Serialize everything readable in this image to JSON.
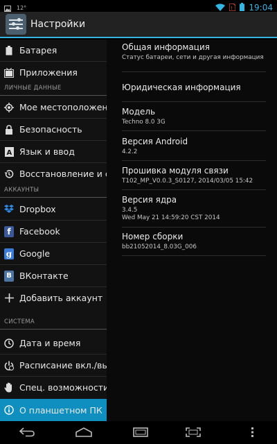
{
  "status_bar": {
    "temperature": "12°",
    "time": "19:04",
    "icons": [
      "picture-icon",
      "wifi-icon",
      "no-sim-icon",
      "battery-icon"
    ]
  },
  "action_bar": {
    "title": "Настройки",
    "icon": "settings-app-icon"
  },
  "sidebar": {
    "items": [
      {
        "label": "Батарея",
        "icon": "battery-icon"
      },
      {
        "label": "Приложения",
        "icon": "apps-icon"
      },
      {
        "label": "Мое местоположен",
        "icon": "location-icon"
      },
      {
        "label": "Безопасность",
        "icon": "lock-icon"
      },
      {
        "label": "Язык и ввод",
        "icon": "keyboard-icon"
      },
      {
        "label": "Восстановление и с",
        "icon": "restore-icon"
      },
      {
        "label": "Dropbox",
        "icon": "dropbox-icon"
      },
      {
        "label": "Facebook",
        "icon": "facebook-icon"
      },
      {
        "label": "Google",
        "icon": "google-icon"
      },
      {
        "label": "ВКонтакте",
        "icon": "vk-icon"
      },
      {
        "label": "Добавить аккаунт",
        "icon": "plus-icon"
      },
      {
        "label": "Дата и время",
        "icon": "clock-icon"
      },
      {
        "label": "Расписание вкл./вы",
        "icon": "power-icon"
      },
      {
        "label": "Спец. возможности",
        "icon": "hand-icon"
      },
      {
        "label": "О планшетном ПК",
        "icon": "info-icon"
      }
    ],
    "sections": {
      "personal": "ЛИЧНЫЕ ДАННЫЕ",
      "accounts": "АККАУНТЫ",
      "system": "СИСТЕМА"
    },
    "selected": "О планшетном ПК"
  },
  "about": {
    "entries": [
      {
        "title": "Общая информация",
        "sub": "Статус батареи, сети и другая информация"
      },
      {
        "title": "Юридическая информация",
        "sub": ""
      },
      {
        "title": "Модель",
        "sub": "Techno 8.0 3G"
      },
      {
        "title": "Версия Android",
        "sub": "4.2.2"
      },
      {
        "title": "Прошивка модуля связи",
        "sub": "T102_MP_V0.0.3_S0127, 2014/03/05 15:42"
      },
      {
        "title": "Версия ядра",
        "sub": "3.4.5",
        "sub2": "Wed May 21 14:59:20 CST 2014"
      },
      {
        "title": "Номер сборки",
        "sub": "bb21052014_8.03G_006"
      }
    ]
  },
  "colors": {
    "accent": "#33b5e5",
    "selected_bg": "#0f8fc0"
  },
  "nav_bar": [
    "back-icon",
    "home-icon",
    "recents-icon",
    "fullscreen-icon",
    "menu-icon"
  ]
}
